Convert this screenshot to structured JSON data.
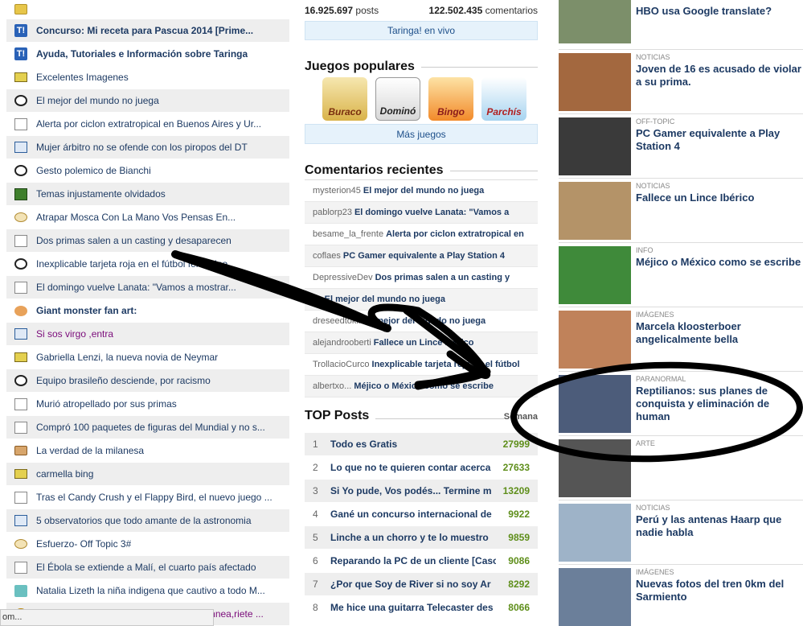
{
  "left_posts": [
    {
      "icon": "folder-icon",
      "title": "",
      "bold": true,
      "alt": false
    },
    {
      "icon": "taringa-icon",
      "title": "Concurso: Mi receta para Pascua 2014 [Prime...",
      "bold": true,
      "alt": true
    },
    {
      "icon": "taringa-icon",
      "title": "Ayuda, Tutoriales e Información sobre Taringa",
      "bold": true,
      "alt": false
    },
    {
      "icon": "image-icon",
      "title": "Excelentes Imagenes",
      "bold": false,
      "alt": false
    },
    {
      "icon": "soccer-ball-icon",
      "title": "El mejor del mundo no juega",
      "bold": false,
      "alt": true
    },
    {
      "icon": "document-icon",
      "title": "Alerta por ciclon extratropical en Buenos Aires y Ur...",
      "bold": false,
      "alt": false
    },
    {
      "icon": "book-icon",
      "title": "Mujer árbitro no se ofende con los piropos del DT",
      "bold": false,
      "alt": true
    },
    {
      "icon": "soccer-ball-icon",
      "title": "Gesto polemico de Bianchi",
      "bold": false,
      "alt": false
    },
    {
      "icon": "film-icon",
      "title": "Temas injustamente olvidados",
      "bold": false,
      "alt": true
    },
    {
      "icon": "chat-icon",
      "title": "Atrapar Mosca Con La Mano Vos Pensas En...",
      "bold": false,
      "alt": false
    },
    {
      "icon": "document-icon",
      "title": "Dos primas salen a un casting y desaparecen",
      "bold": false,
      "alt": true
    },
    {
      "icon": "soccer-ball-icon",
      "title": "Inexplicable tarjeta roja en el fútbol femenino",
      "bold": false,
      "alt": false
    },
    {
      "icon": "document-icon",
      "title": "El domingo vuelve Lanata: \"Vamos a mostrar...",
      "bold": false,
      "alt": true
    },
    {
      "icon": "palette-icon",
      "title": "Giant monster fan art:",
      "bold": true,
      "alt": false
    },
    {
      "icon": "book-icon",
      "title": "Si sos virgo ,entra",
      "bold": false,
      "alt": true,
      "purple": true
    },
    {
      "icon": "image-icon",
      "title": "Gabriella Lenzi, la nueva novia de Neymar",
      "bold": false,
      "alt": false
    },
    {
      "icon": "soccer-ball-icon",
      "title": "Equipo brasileño desciende, por racismo",
      "bold": false,
      "alt": true
    },
    {
      "icon": "document-icon",
      "title": "Murió atropellado por sus primas",
      "bold": false,
      "alt": false
    },
    {
      "icon": "document-icon",
      "title": "Compró 100 paquetes de figuras del Mundial y no s...",
      "bold": false,
      "alt": true
    },
    {
      "icon": "food-icon",
      "title": "La verdad de la milanesa",
      "bold": false,
      "alt": false
    },
    {
      "icon": "image-icon",
      "title": "carmella bing",
      "bold": false,
      "alt": true
    },
    {
      "icon": "document-icon",
      "title": "Tras el Candy Crush y el Flappy Bird, el nuevo juego ...",
      "bold": false,
      "alt": false
    },
    {
      "icon": "book-icon",
      "title": "5 observatorios que todo amante de la astronomia",
      "bold": false,
      "alt": true
    },
    {
      "icon": "chat-icon",
      "title": "Esfuerzo- Off Topic 3#",
      "bold": false,
      "alt": false
    },
    {
      "icon": "document-icon",
      "title": "El Ébola se extiende a Malí, el cuarto país afectado",
      "bold": false,
      "alt": true
    },
    {
      "icon": "test-tube-icon",
      "title": "Natalia Lizeth la niña indigena que cautivo a todo M...",
      "bold": false,
      "alt": false
    },
    {
      "icon": "smiley-icon",
      "title": "Si no sales perturbado y taringa no te bannea,riete ...",
      "bold": false,
      "alt": true,
      "purple": true
    }
  ],
  "stats": {
    "posts": "16.925.697",
    "posts_label": "posts",
    "comments": "122.502.435",
    "comments_label": "comentarios"
  },
  "live_label": "Taringa! en vivo",
  "games": {
    "title": "Juegos populares",
    "items": [
      "Buraco",
      "Dominó",
      "Bingo",
      "Parchís"
    ],
    "more_label": "Más juegos"
  },
  "recent_comments": {
    "title": "Comentarios recientes",
    "items": [
      {
        "user": "mysterion45",
        "post": "El mejor del mundo no juega"
      },
      {
        "user": "pablorp23",
        "post": "El domingo vuelve Lanata: \"Vamos a"
      },
      {
        "user": "besame_la_frente",
        "post": "Alerta por ciclon extratropical en"
      },
      {
        "user": "coflaes",
        "post": "PC Gamer equivalente a Play Station 4"
      },
      {
        "user": "DepressiveDev",
        "post": "Dos primas salen a un casting y"
      },
      {
        "user": "l...",
        "post": "El mejor del mundo no juega"
      },
      {
        "user": "dreseedtokill",
        "post": "El mejor del mundo no juega"
      },
      {
        "user": "alejandrooberti",
        "post": "Fallece un Lince Ibérico"
      },
      {
        "user": "TrollacioCurco",
        "post": "Inexplicable tarjeta roja en el fútbol"
      },
      {
        "user": "albertxo...",
        "post": "Méjico o México como se escribe"
      }
    ]
  },
  "top_posts": {
    "title": "TOP Posts",
    "period": "Semana",
    "items": [
      {
        "rank": "1",
        "title": "Todo es Gratis",
        "score": "27999"
      },
      {
        "rank": "2",
        "title": "Lo que no te quieren contar acerca",
        "score": "27633"
      },
      {
        "rank": "3",
        "title": "Si Yo pude, Vos podés... Termine m",
        "score": "13209"
      },
      {
        "rank": "4",
        "title": "Gané un concurso internacional de",
        "score": "9922"
      },
      {
        "rank": "5",
        "title": "Linche a un chorro y te lo muestro",
        "score": "9859"
      },
      {
        "rank": "6",
        "title": "Reparando la PC de un cliente [Caso",
        "score": "9086"
      },
      {
        "rank": "7",
        "title": "¿Por que Soy de River si no soy Ar",
        "score": "8292"
      },
      {
        "rank": "8",
        "title": "Me hice una guitarra Telecaster des",
        "score": "8066"
      }
    ]
  },
  "news": [
    {
      "category": "",
      "title": "HBO usa Google translate?",
      "thumb_color": "#7c8f6a"
    },
    {
      "category": "NOTICIAS",
      "title": "Joven de 16 es acusado de violar a su prima.",
      "thumb_color": "#a3683f"
    },
    {
      "category": "OFF-TOPIC",
      "title": "PC Gamer equivalente a Play Station 4",
      "thumb_color": "#3a3a3a"
    },
    {
      "category": "NOTICIAS",
      "title": "Fallece un Lince Ibérico",
      "thumb_color": "#b49368"
    },
    {
      "category": "INFO",
      "title": "Méjico o México como se escribe",
      "thumb_color": "#3f8a3a"
    },
    {
      "category": "IMÁGENES",
      "title": "Marcela kloosterboer angelicalmente bella",
      "thumb_color": "#c0825a"
    },
    {
      "category": "PARANORMAL",
      "title": "Reptilianos: sus planes de conquista y eliminación de human",
      "thumb_color": "#4c5c7a"
    },
    {
      "category": "ARTE",
      "title": "",
      "thumb_color": "#555555"
    },
    {
      "category": "NOTICIAS",
      "title": "Perú y las antenas Haarp que nadie habla",
      "thumb_color": "#9eb3c8"
    },
    {
      "category": "IMÁGENES",
      "title": "Nuevas fotos del tren 0km del Sarmiento",
      "thumb_color": "#6b7f9a"
    }
  ],
  "status_text": "om...",
  "colors": {
    "link": "#1d3a63",
    "accent_green": "#5e8e1a",
    "live_bar": "#e6f2fb"
  }
}
